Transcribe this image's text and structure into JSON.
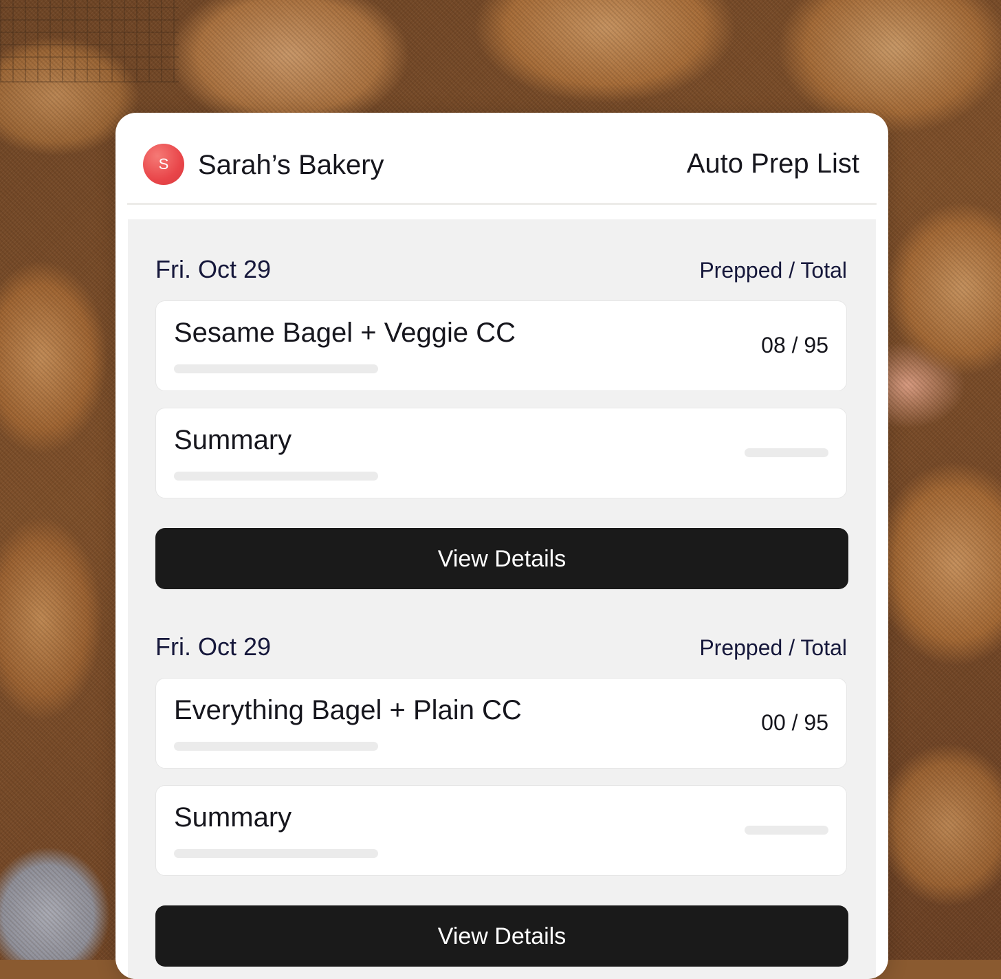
{
  "header": {
    "avatar_letter": "S",
    "brand_name": "Sarah’s Bakery",
    "page_title": "Auto Prep List"
  },
  "sections": [
    {
      "date": "Fri. Oct 29",
      "column_header": "Prepped / Total",
      "item": {
        "name": "Sesame Bagel + Veggie CC",
        "count": "08 / 95"
      },
      "summary": {
        "label": "Summary"
      },
      "button_label": "View Details"
    },
    {
      "date": "Fri. Oct 29",
      "column_header": "Prepped / Total",
      "item": {
        "name": "Everything Bagel + Plain CC",
        "count": "00 / 95"
      },
      "summary": {
        "label": "Summary"
      },
      "button_label": "View Details"
    }
  ],
  "colors": {
    "accent": "#e9464a",
    "button": "#1a1a1a",
    "panel": "#f1f1f1",
    "heading": "#16183b"
  }
}
